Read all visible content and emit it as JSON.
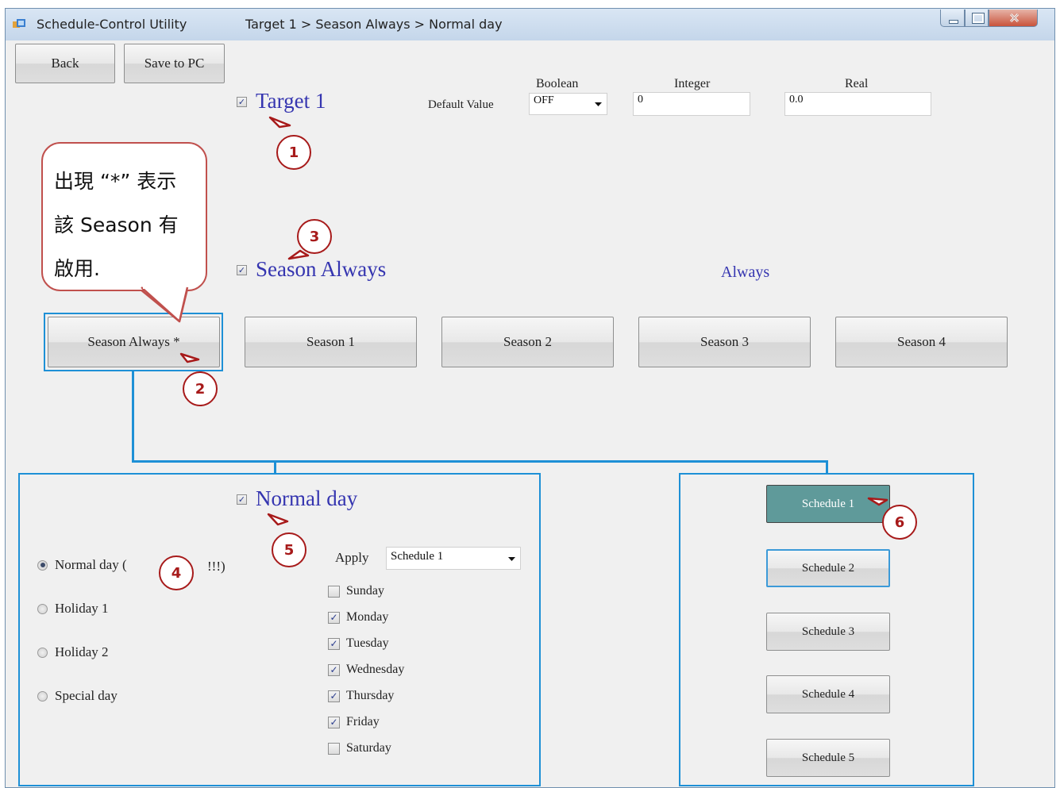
{
  "window": {
    "app_title": "Schedule-Control Utility",
    "breadcrumb": "Target 1 > Season Always > Normal day"
  },
  "toolbar": {
    "back_label": "Back",
    "save_label": "Save to PC"
  },
  "target": {
    "title": "Target 1",
    "checked": true,
    "default_value_label": "Default Value",
    "boolean_header": "Boolean",
    "integer_header": "Integer",
    "real_header": "Real",
    "boolean_value": "OFF",
    "integer_value": "0",
    "real_value": "0.0"
  },
  "season": {
    "title": "Season Always",
    "checked": true,
    "range_label": "Always",
    "buttons": [
      "Season Always *",
      "Season 1",
      "Season 2",
      "Season 3",
      "Season 4"
    ]
  },
  "day": {
    "title": "Normal day",
    "checked": true,
    "types": [
      {
        "label": "Normal day (",
        "tail": "!!!)",
        "selected": true
      },
      {
        "label": "Holiday 1",
        "selected": false
      },
      {
        "label": "Holiday 2",
        "selected": false
      },
      {
        "label": "Special day",
        "selected": false
      }
    ],
    "apply_label": "Apply",
    "apply_value": "Schedule 1",
    "weekdays": [
      {
        "label": "Sunday",
        "checked": false
      },
      {
        "label": "Monday",
        "checked": true
      },
      {
        "label": "Tuesday",
        "checked": true
      },
      {
        "label": "Wednesday",
        "checked": true
      },
      {
        "label": "Thursday",
        "checked": true
      },
      {
        "label": "Friday",
        "checked": true
      },
      {
        "label": "Saturday",
        "checked": false
      }
    ]
  },
  "schedules": [
    "Schedule 1",
    "Schedule 2",
    "Schedule 3",
    "Schedule 4",
    "Schedule 5"
  ],
  "annotations": {
    "callouts": [
      "1",
      "2",
      "3",
      "4",
      "5",
      "6"
    ],
    "speech_bubble": "出現 “*” 表示該 Season 有啟用."
  },
  "colors": {
    "heading": "#3535b0",
    "connector": "#1e90d6",
    "schedule_selected": "#5f9a9a",
    "callout": "#a71a1a",
    "bubble_border": "#c0504d"
  }
}
